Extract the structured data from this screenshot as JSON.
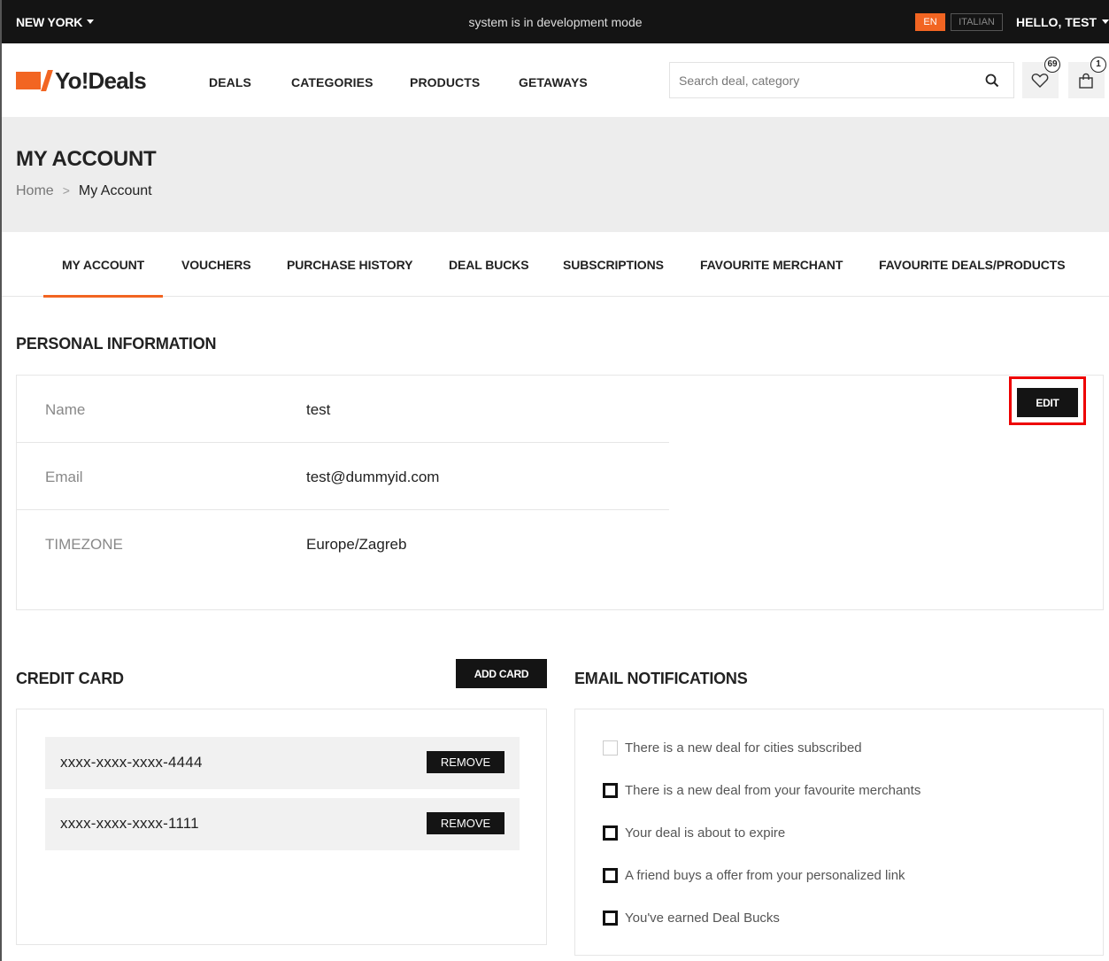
{
  "topbar": {
    "city": "NEW YORK",
    "dev_mode": "system is in development mode",
    "lang_en": "EN",
    "lang_italian": "ITALIAN",
    "greeting": "HELLO, TEST"
  },
  "header": {
    "logo_text": "Yo!Deals",
    "nav": [
      "DEALS",
      "CATEGORIES",
      "PRODUCTS",
      "GETAWAYS"
    ],
    "search_placeholder": "Search deal, category",
    "wishlist_count": "69",
    "cart_count": "1",
    "accent_color": "#f26522"
  },
  "page": {
    "title": "MY ACCOUNT",
    "breadcrumb_home": "Home",
    "breadcrumb_current": "My Account"
  },
  "tabs": [
    "MY ACCOUNT",
    "VOUCHERS",
    "PURCHASE HISTORY",
    "DEAL BUCKS",
    "SUBSCRIPTIONS",
    "FAVOURITE MERCHANT",
    "FAVOURITE DEALS/PRODUCTS"
  ],
  "personal": {
    "title": "PERSONAL INFORMATION",
    "edit_label": "EDIT",
    "rows": [
      {
        "label": "Name",
        "value": "test"
      },
      {
        "label": "Email",
        "value": "test@dummyid.com"
      },
      {
        "label": "TIMEZONE",
        "value": "Europe/Zagreb"
      }
    ]
  },
  "credit_card": {
    "title": "CREDIT CARD",
    "add_label": "ADD CARD",
    "remove_label": "REMOVE",
    "cards": [
      "xxxx-xxxx-xxxx-4444",
      "xxxx-xxxx-xxxx-1111"
    ]
  },
  "notifications": {
    "title": "EMAIL NOTIFICATIONS",
    "items": [
      {
        "text": "There is a new deal for cities subscribed",
        "checked": false
      },
      {
        "text": "There is a new deal from your favourite merchants",
        "checked": true
      },
      {
        "text": "Your deal is about to expire",
        "checked": true
      },
      {
        "text": "A friend buys a offer from your personalized link",
        "checked": true
      },
      {
        "text": "You've earned Deal Bucks",
        "checked": true
      }
    ]
  }
}
